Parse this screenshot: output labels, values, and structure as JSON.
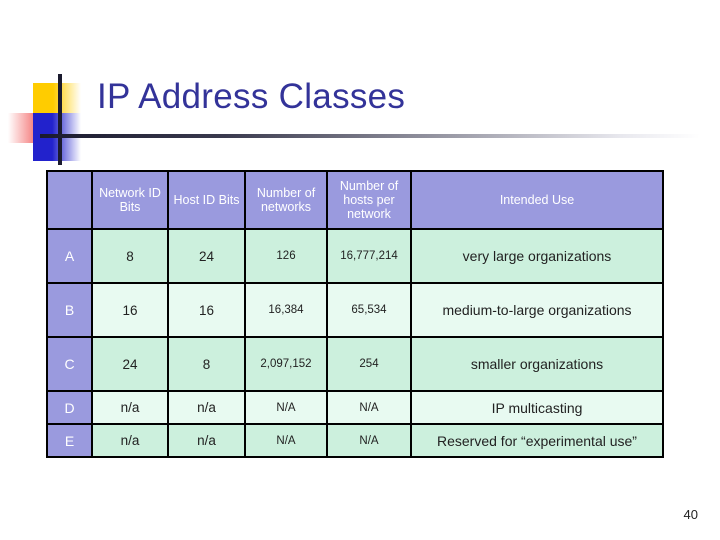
{
  "slide": {
    "title": "IP Address Classes",
    "page_number": "40",
    "title_color": "#333399",
    "header_fill": "#9a9ade",
    "row_shade_dark": "#ccf0dd",
    "row_shade_light": "#e8faf1",
    "border_color": "#000000"
  },
  "table": {
    "headers": [
      "",
      "Network ID Bits",
      "Host ID Bits",
      "Number of networks",
      "Number of hosts per network",
      "Intended Use"
    ],
    "rows": [
      {
        "class": "A",
        "network_id_bits": "8",
        "host_id_bits": "24",
        "number_of_networks": "126",
        "hosts_per_network": "16,777,214",
        "intended_use": "very large organizations"
      },
      {
        "class": "B",
        "network_id_bits": "16",
        "host_id_bits": "16",
        "number_of_networks": "16,384",
        "hosts_per_network": "65,534",
        "intended_use": "medium-to-large organizations"
      },
      {
        "class": "C",
        "network_id_bits": "24",
        "host_id_bits": "8",
        "number_of_networks": "2,097,152",
        "hosts_per_network": "254",
        "intended_use": "smaller organizations"
      },
      {
        "class": "D",
        "network_id_bits": "n/a",
        "host_id_bits": "n/a",
        "number_of_networks": "N/A",
        "hosts_per_network": "N/A",
        "intended_use": "IP multicasting"
      },
      {
        "class": "E",
        "network_id_bits": "n/a",
        "host_id_bits": "n/a",
        "number_of_networks": "N/A",
        "hosts_per_network": "N/A",
        "intended_use": "Reserved for “experimental use”"
      }
    ]
  }
}
